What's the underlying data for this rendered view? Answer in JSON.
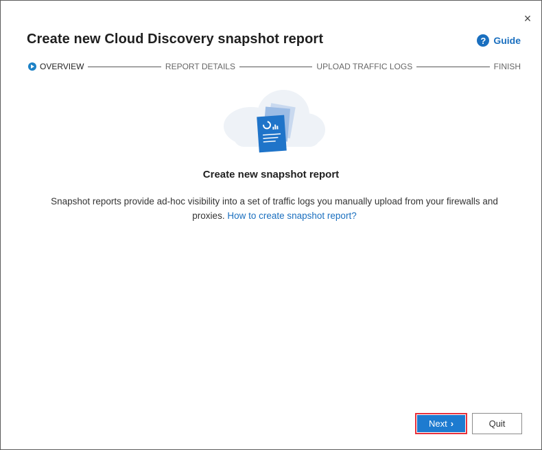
{
  "dialog": {
    "title": "Create new Cloud Discovery snapshot report",
    "close_glyph": "×",
    "guide_label": "Guide",
    "guide_icon_glyph": "?"
  },
  "stepper": {
    "steps": [
      {
        "label": "OVERVIEW",
        "active": true
      },
      {
        "label": "REPORT DETAILS",
        "active": false
      },
      {
        "label": "UPLOAD TRAFFIC LOGS",
        "active": false
      },
      {
        "label": "FINISH",
        "active": false
      }
    ]
  },
  "content": {
    "heading": "Create new snapshot report",
    "description": "Snapshot reports provide ad-hoc visibility into a set of traffic logs you manually upload from your firewalls and proxies.",
    "link_text": "How to create snapshot report?"
  },
  "footer": {
    "next_label": "Next",
    "next_chevron": "›",
    "quit_label": "Quit"
  },
  "colors": {
    "accent": "#1d7bd0",
    "link": "#1a6fbf",
    "highlight_border": "#e8303a"
  },
  "icons": {
    "close": "close-icon",
    "guide": "help-circle-icon",
    "step_active": "play-circle-icon",
    "hero": "cloud-report-illustration"
  }
}
